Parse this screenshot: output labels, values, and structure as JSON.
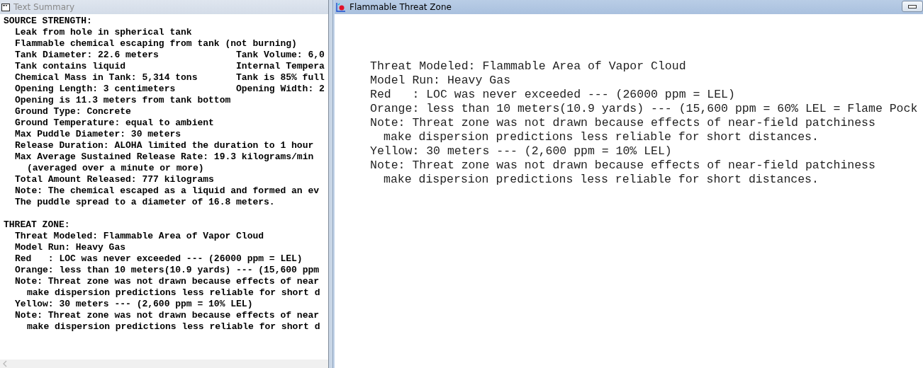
{
  "summary_window": {
    "title": "Text Summary",
    "active": false,
    "sections": [
      {
        "heading": "SOURCE STRENGTH:",
        "lines": [
          {
            "text": "Leak from hole in spherical tank"
          },
          {
            "text": "Flammable chemical escaping from tank (not burning)"
          },
          {
            "text": "Tank Diameter: 22.6 meters",
            "column_2": "Tank Volume: 6,0"
          },
          {
            "text": "Tank contains liquid",
            "column_2": "Internal Tempera"
          },
          {
            "text": "Chemical Mass in Tank: 5,314 tons",
            "column_2": "Tank is 85% full"
          },
          {
            "text": "Opening Length: 3 centimeters",
            "column_2": "Opening Width: 2"
          },
          {
            "text": "Opening is 11.3 meters from tank bottom"
          },
          {
            "text": "Ground Type: Concrete"
          },
          {
            "text": "Ground Temperature: equal to ambient"
          },
          {
            "text": "Max Puddle Diameter: 30 meters"
          },
          {
            "text": "Release Duration: ALOHA limited the duration to 1 hour"
          },
          {
            "text": "Max Average Sustained Release Rate: 19.3 kilograms/min",
            "children": [
              {
                "text": "(averaged over a minute or more)"
              }
            ]
          },
          {
            "text": "Total Amount Released: 777 kilograms"
          },
          {
            "text": "Note: The chemical escaped as a liquid and formed an ev"
          },
          {
            "text": "The puddle spread to a diameter of 16.8 meters."
          }
        ]
      },
      {
        "heading": "THREAT ZONE:",
        "lines": [
          {
            "text": "Threat Modeled: Flammable Area of Vapor Cloud"
          },
          {
            "text": "Model Run: Heavy Gas"
          },
          {
            "text": "Red   : LOC was never exceeded --- (26000 ppm = LEL)"
          },
          {
            "text": "Orange: less than 10 meters(10.9 yards) --- (15,600 ppm"
          },
          {
            "text": "Note: Threat zone was not drawn because effects of near",
            "children": [
              {
                "text": "make dispersion predictions less reliable for short d"
              }
            ]
          },
          {
            "text": "Yellow: 30 meters --- (2,600 ppm = 10% LEL)"
          },
          {
            "text": "Note: Threat zone was not drawn because effects of near",
            "children": [
              {
                "text": "make dispersion predictions less reliable for short d"
              }
            ]
          }
        ]
      }
    ]
  },
  "threat_window": {
    "title": "Flammable Threat Zone",
    "active": true,
    "lines": [
      {
        "text": "Threat Modeled: Flammable Area of Vapor Cloud"
      },
      {
        "text": "Model Run: Heavy Gas"
      },
      {
        "text": "Red   : LOC was never exceeded --- (26000 ppm = LEL)"
      },
      {
        "text": "Orange: less than 10 meters(10.9 yards) --- (15,600 ppm = 60% LEL = Flame Pock"
      },
      {
        "text": "Note: Threat zone was not drawn because effects of near-field patchiness",
        "children": [
          {
            "text": "make dispersion predictions less reliable for short distances."
          }
        ]
      },
      {
        "text": "Yellow: 30 meters --- (2,600 ppm = 10% LEL)"
      },
      {
        "text": "Note: Threat zone was not drawn because effects of near-field patchiness",
        "children": [
          {
            "text": "make dispersion predictions less reliable for short distances."
          }
        ]
      }
    ]
  }
}
